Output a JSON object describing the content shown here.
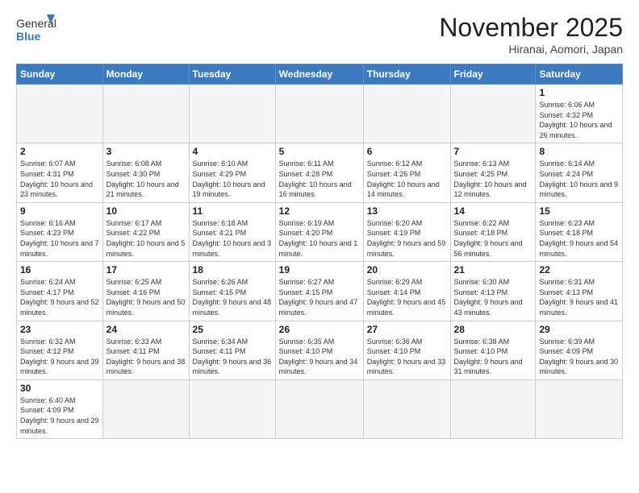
{
  "header": {
    "logo_general": "General",
    "logo_blue": "Blue",
    "month_title": "November 2025",
    "location": "Hiranai, Aomori, Japan"
  },
  "days_of_week": [
    "Sunday",
    "Monday",
    "Tuesday",
    "Wednesday",
    "Thursday",
    "Friday",
    "Saturday"
  ],
  "weeks": [
    [
      {
        "day": "",
        "info": ""
      },
      {
        "day": "",
        "info": ""
      },
      {
        "day": "",
        "info": ""
      },
      {
        "day": "",
        "info": ""
      },
      {
        "day": "",
        "info": ""
      },
      {
        "day": "",
        "info": ""
      },
      {
        "day": "1",
        "info": "Sunrise: 6:06 AM\nSunset: 4:32 PM\nDaylight: 10 hours and 26 minutes."
      }
    ],
    [
      {
        "day": "2",
        "info": "Sunrise: 6:07 AM\nSunset: 4:31 PM\nDaylight: 10 hours and 23 minutes."
      },
      {
        "day": "3",
        "info": "Sunrise: 6:08 AM\nSunset: 4:30 PM\nDaylight: 10 hours and 21 minutes."
      },
      {
        "day": "4",
        "info": "Sunrise: 6:10 AM\nSunset: 4:29 PM\nDaylight: 10 hours and 19 minutes."
      },
      {
        "day": "5",
        "info": "Sunrise: 6:11 AM\nSunset: 4:28 PM\nDaylight: 10 hours and 16 minutes."
      },
      {
        "day": "6",
        "info": "Sunrise: 6:12 AM\nSunset: 4:26 PM\nDaylight: 10 hours and 14 minutes."
      },
      {
        "day": "7",
        "info": "Sunrise: 6:13 AM\nSunset: 4:25 PM\nDaylight: 10 hours and 12 minutes."
      },
      {
        "day": "8",
        "info": "Sunrise: 6:14 AM\nSunset: 4:24 PM\nDaylight: 10 hours and 9 minutes."
      }
    ],
    [
      {
        "day": "9",
        "info": "Sunrise: 6:16 AM\nSunset: 4:23 PM\nDaylight: 10 hours and 7 minutes."
      },
      {
        "day": "10",
        "info": "Sunrise: 6:17 AM\nSunset: 4:22 PM\nDaylight: 10 hours and 5 minutes."
      },
      {
        "day": "11",
        "info": "Sunrise: 6:18 AM\nSunset: 4:21 PM\nDaylight: 10 hours and 3 minutes."
      },
      {
        "day": "12",
        "info": "Sunrise: 6:19 AM\nSunset: 4:20 PM\nDaylight: 10 hours and 1 minute."
      },
      {
        "day": "13",
        "info": "Sunrise: 6:20 AM\nSunset: 4:19 PM\nDaylight: 9 hours and 59 minutes."
      },
      {
        "day": "14",
        "info": "Sunrise: 6:22 AM\nSunset: 4:18 PM\nDaylight: 9 hours and 56 minutes."
      },
      {
        "day": "15",
        "info": "Sunrise: 6:23 AM\nSunset: 4:18 PM\nDaylight: 9 hours and 54 minutes."
      }
    ],
    [
      {
        "day": "16",
        "info": "Sunrise: 6:24 AM\nSunset: 4:17 PM\nDaylight: 9 hours and 52 minutes."
      },
      {
        "day": "17",
        "info": "Sunrise: 6:25 AM\nSunset: 4:16 PM\nDaylight: 9 hours and 50 minutes."
      },
      {
        "day": "18",
        "info": "Sunrise: 6:26 AM\nSunset: 4:15 PM\nDaylight: 9 hours and 48 minutes."
      },
      {
        "day": "19",
        "info": "Sunrise: 6:27 AM\nSunset: 4:15 PM\nDaylight: 9 hours and 47 minutes."
      },
      {
        "day": "20",
        "info": "Sunrise: 6:29 AM\nSunset: 4:14 PM\nDaylight: 9 hours and 45 minutes."
      },
      {
        "day": "21",
        "info": "Sunrise: 6:30 AM\nSunset: 4:13 PM\nDaylight: 9 hours and 43 minutes."
      },
      {
        "day": "22",
        "info": "Sunrise: 6:31 AM\nSunset: 4:13 PM\nDaylight: 9 hours and 41 minutes."
      }
    ],
    [
      {
        "day": "23",
        "info": "Sunrise: 6:32 AM\nSunset: 4:12 PM\nDaylight: 9 hours and 39 minutes."
      },
      {
        "day": "24",
        "info": "Sunrise: 6:33 AM\nSunset: 4:11 PM\nDaylight: 9 hours and 38 minutes."
      },
      {
        "day": "25",
        "info": "Sunrise: 6:34 AM\nSunset: 4:11 PM\nDaylight: 9 hours and 36 minutes."
      },
      {
        "day": "26",
        "info": "Sunrise: 6:35 AM\nSunset: 4:10 PM\nDaylight: 9 hours and 34 minutes."
      },
      {
        "day": "27",
        "info": "Sunrise: 6:36 AM\nSunset: 4:10 PM\nDaylight: 9 hours and 33 minutes."
      },
      {
        "day": "28",
        "info": "Sunrise: 6:38 AM\nSunset: 4:10 PM\nDaylight: 9 hours and 31 minutes."
      },
      {
        "day": "29",
        "info": "Sunrise: 6:39 AM\nSunset: 4:09 PM\nDaylight: 9 hours and 30 minutes."
      }
    ],
    [
      {
        "day": "30",
        "info": "Sunrise: 6:40 AM\nSunset: 4:09 PM\nDaylight: 9 hours and 29 minutes."
      },
      {
        "day": "",
        "info": ""
      },
      {
        "day": "",
        "info": ""
      },
      {
        "day": "",
        "info": ""
      },
      {
        "day": "",
        "info": ""
      },
      {
        "day": "",
        "info": ""
      },
      {
        "day": "",
        "info": ""
      }
    ]
  ]
}
